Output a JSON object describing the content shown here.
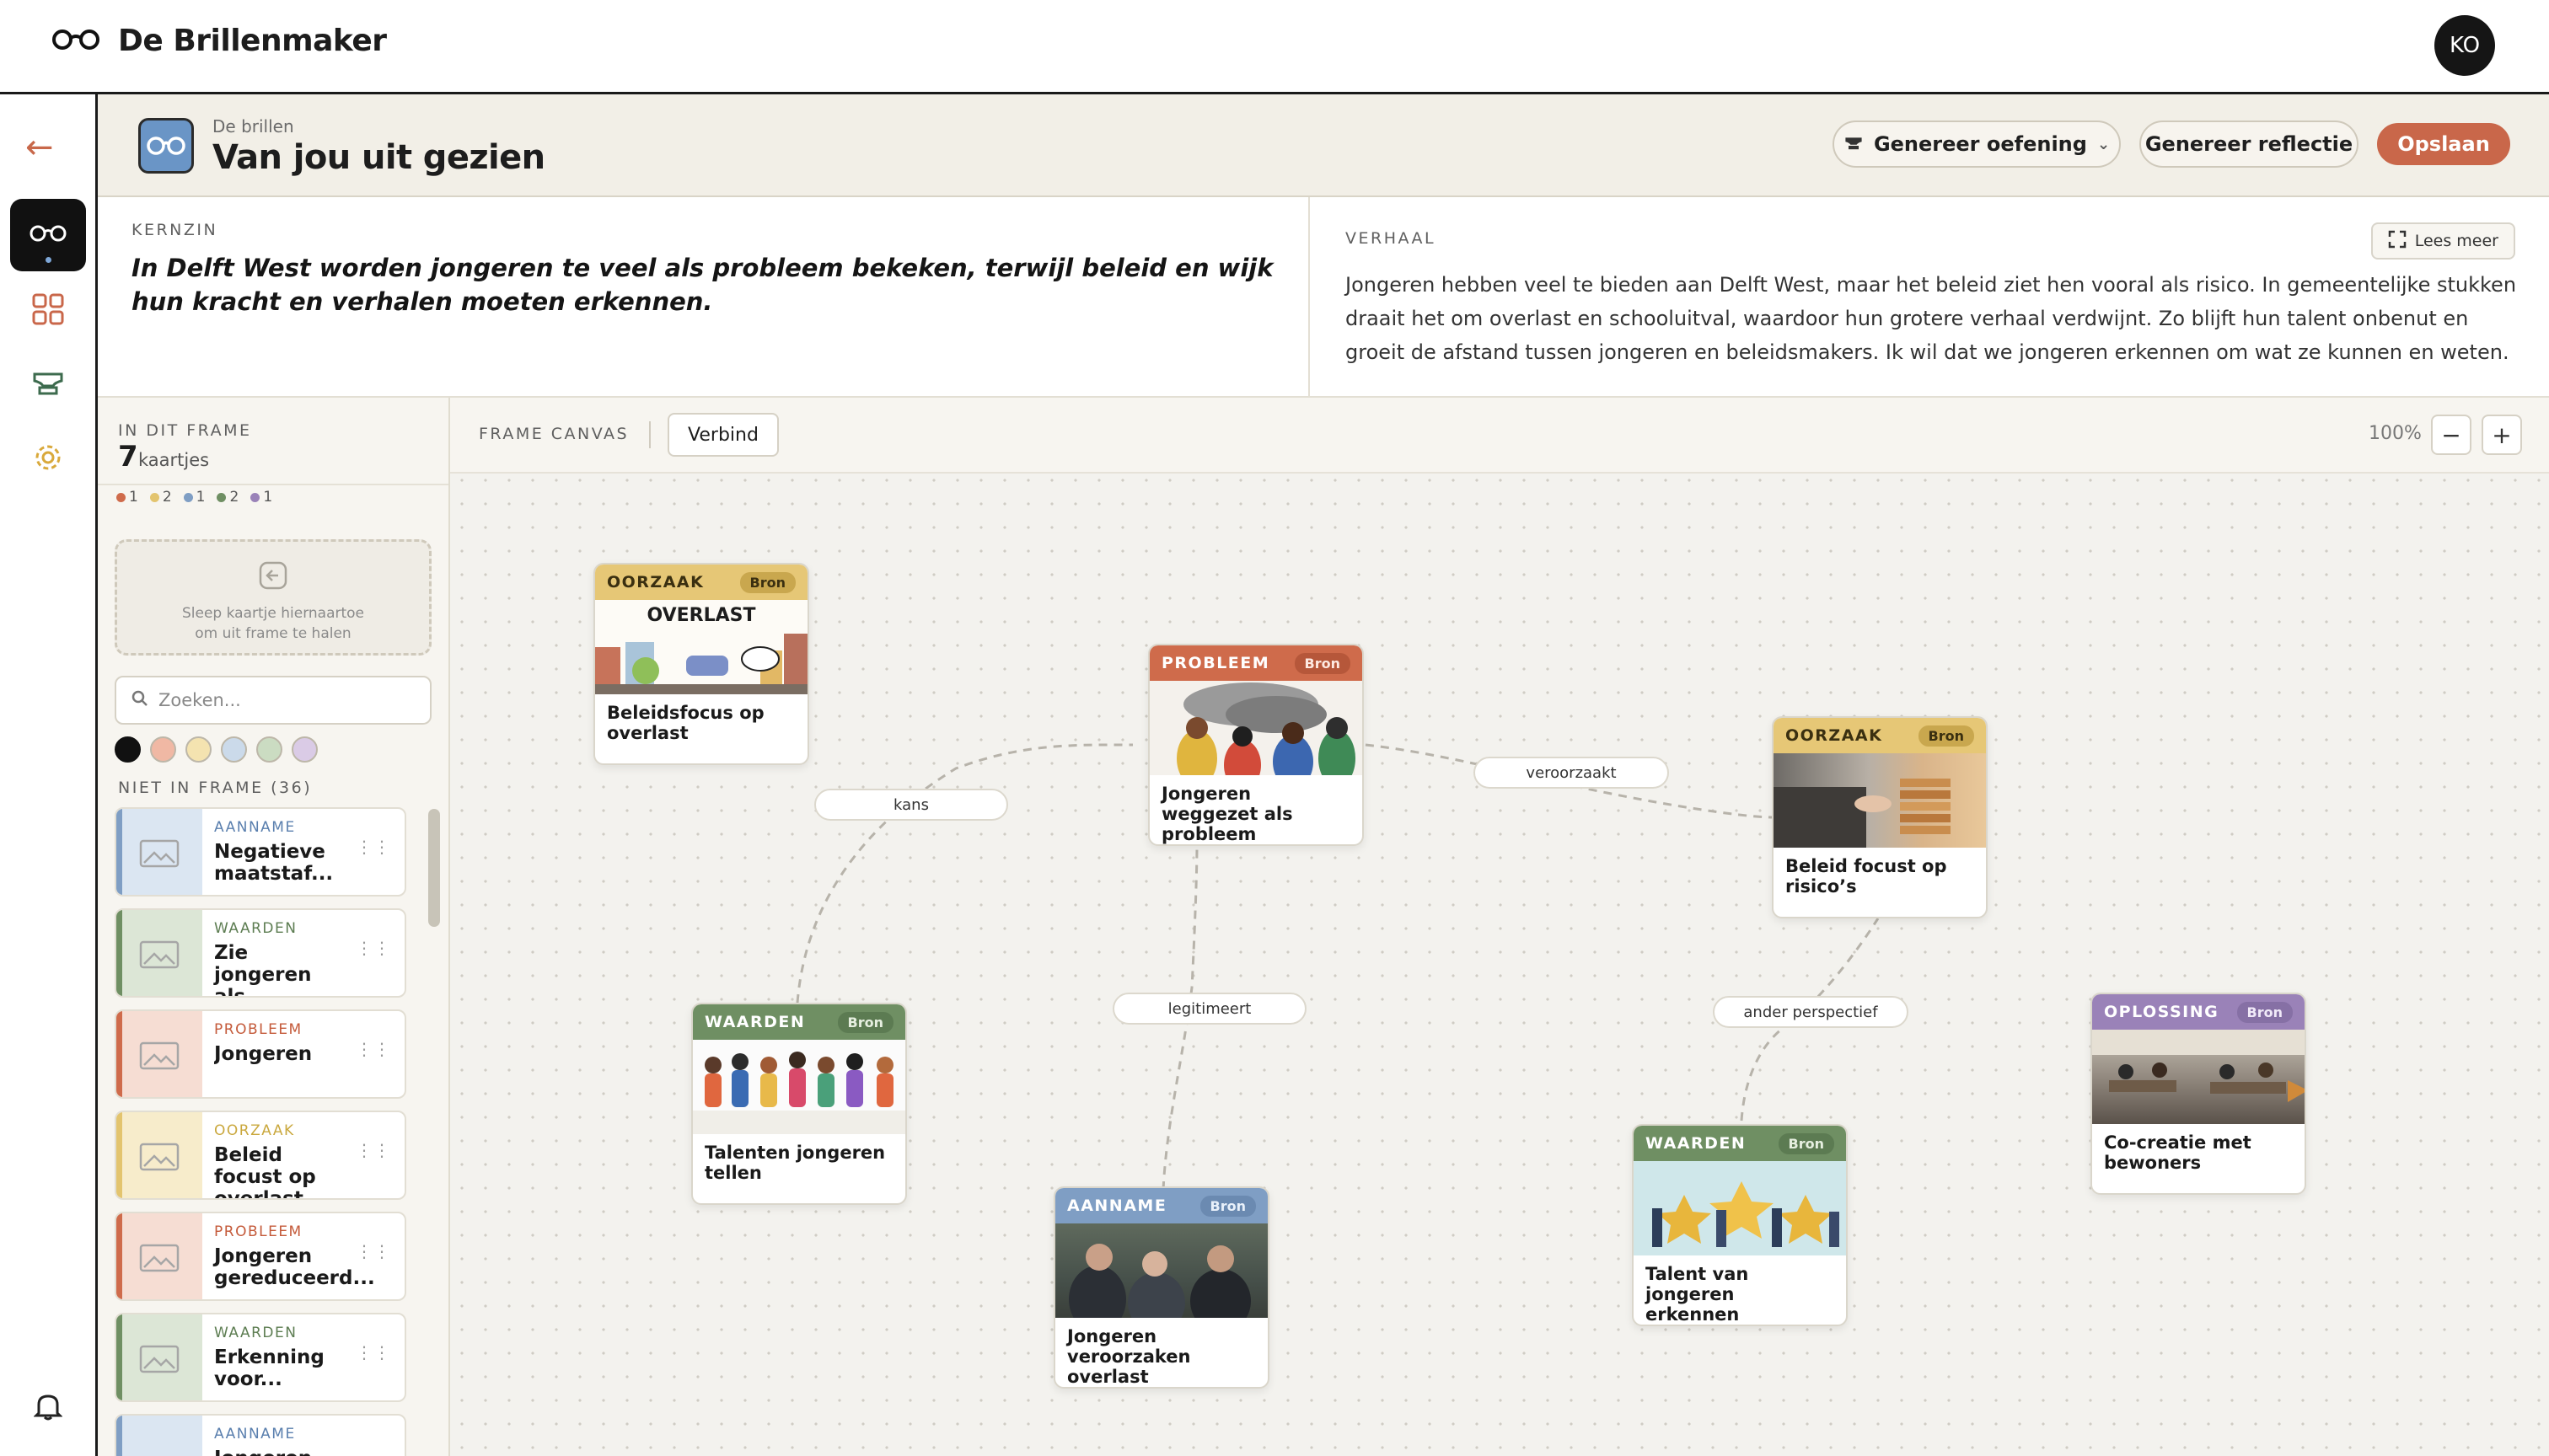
{
  "app": {
    "brand": "De Brillenmaker",
    "user_initials": "KO"
  },
  "colors": {
    "oorzaak": "#e3c46e",
    "probleem": "#cf6b4b",
    "aanname": "#7f9ec4",
    "waarden": "#6f8f63",
    "oplossing": "#9a82b8",
    "primary": "#c9674a"
  },
  "header": {
    "breadcrumb": "De brillen",
    "title": "Van jou uit gezien",
    "generate_exercise": "Genereer oefening",
    "generate_reflection": "Genereer reflectie",
    "save": "Opslaan"
  },
  "kernzin": {
    "label": "KERNZIN",
    "text": "In Delft West worden jongeren te veel als probleem bekeken, terwijl beleid en wijk hun kracht en verhalen moeten erkennen."
  },
  "verhaal": {
    "label": "VERHAAL",
    "read_more": "Lees meer",
    "text": "Jongeren hebben veel te bieden aan Delft West, maar het beleid ziet hen vooral als risico. In gemeentelijke stukken draait het om overlast en schooluitval, waardoor hun grotere verhaal verdwijnt. Zo blijft hun talent onbenut en groeit de afstand tussen jongeren en beleidsmakers. Ik wil dat we jongeren erkennen om wat ze kunnen en weten."
  },
  "panel": {
    "in_frame_label": "IN DIT FRAME",
    "count": "7",
    "count_unit": "kaartjes",
    "legend": [
      "1",
      "2",
      "1",
      "2",
      "1"
    ],
    "dropzone_line1": "Sleep kaartje hiernaartoe",
    "dropzone_line2": "om uit frame te halen",
    "search_placeholder": "Zoeken...",
    "not_in_frame_label": "NIET IN FRAME (36)",
    "items": [
      {
        "category": "AANNAME",
        "title": "Negatieve maatstaf..."
      },
      {
        "category": "WAARDEN",
        "title": "Zie jongeren als kracht"
      },
      {
        "category": "PROBLEEM",
        "title": "Jongeren als probleembeeld"
      },
      {
        "category": "OORZAAK",
        "title": "Beleid focust op overlast"
      },
      {
        "category": "PROBLEEM",
        "title": "Jongeren gereduceerd..."
      },
      {
        "category": "WAARDEN",
        "title": "Erkenning voor..."
      },
      {
        "category": "AANNAME",
        "title": "Jongeren zijn..."
      }
    ]
  },
  "canvas": {
    "label": "FRAME CANVAS",
    "connect": "Verbind",
    "zoom": "100%",
    "zoom_out": "−",
    "zoom_in": "+",
    "edges": [
      "kans",
      "veroorzaakt",
      "legitimeert",
      "ander perspectief"
    ],
    "cards": [
      {
        "category": "OORZAAK",
        "badge": "Bron",
        "image_caption": "OVERLAST",
        "title": "Beleidsfocus op overlast"
      },
      {
        "category": "PROBLEEM",
        "badge": "Bron",
        "title": "Jongeren weggezet als probleem"
      },
      {
        "category": "OORZAAK",
        "badge": "Bron",
        "title": "Beleid focust op risico’s"
      },
      {
        "category": "WAARDEN",
        "badge": "Bron",
        "title": "Talenten jongeren tellen"
      },
      {
        "category": "AANNAME",
        "badge": "Bron",
        "title": "Jongeren veroorzaken overlast"
      },
      {
        "category": "WAARDEN",
        "badge": "Bron",
        "title": "Talent van jongeren erkennen"
      },
      {
        "category": "OPLOSSING",
        "badge": "Bron",
        "title": "Co-creatie met bewoners"
      }
    ]
  }
}
